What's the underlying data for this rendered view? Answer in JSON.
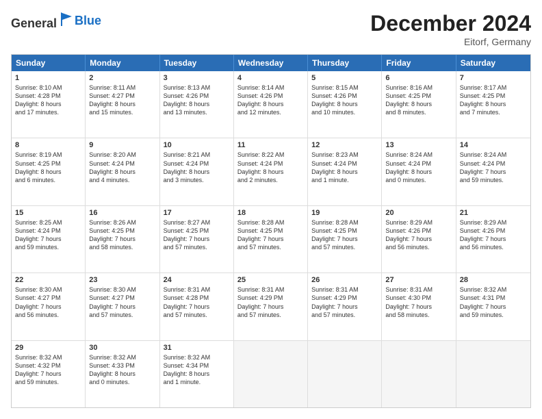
{
  "header": {
    "logo_general": "General",
    "logo_blue": "Blue",
    "title": "December 2024",
    "subtitle": "Eitorf, Germany"
  },
  "days": [
    "Sunday",
    "Monday",
    "Tuesday",
    "Wednesday",
    "Thursday",
    "Friday",
    "Saturday"
  ],
  "rows": [
    [
      {
        "day": "1",
        "lines": [
          "Sunrise: 8:10 AM",
          "Sunset: 4:28 PM",
          "Daylight: 8 hours",
          "and 17 minutes."
        ]
      },
      {
        "day": "2",
        "lines": [
          "Sunrise: 8:11 AM",
          "Sunset: 4:27 PM",
          "Daylight: 8 hours",
          "and 15 minutes."
        ]
      },
      {
        "day": "3",
        "lines": [
          "Sunrise: 8:13 AM",
          "Sunset: 4:26 PM",
          "Daylight: 8 hours",
          "and 13 minutes."
        ]
      },
      {
        "day": "4",
        "lines": [
          "Sunrise: 8:14 AM",
          "Sunset: 4:26 PM",
          "Daylight: 8 hours",
          "and 12 minutes."
        ]
      },
      {
        "day": "5",
        "lines": [
          "Sunrise: 8:15 AM",
          "Sunset: 4:26 PM",
          "Daylight: 8 hours",
          "and 10 minutes."
        ]
      },
      {
        "day": "6",
        "lines": [
          "Sunrise: 8:16 AM",
          "Sunset: 4:25 PM",
          "Daylight: 8 hours",
          "and 8 minutes."
        ]
      },
      {
        "day": "7",
        "lines": [
          "Sunrise: 8:17 AM",
          "Sunset: 4:25 PM",
          "Daylight: 8 hours",
          "and 7 minutes."
        ]
      }
    ],
    [
      {
        "day": "8",
        "lines": [
          "Sunrise: 8:19 AM",
          "Sunset: 4:25 PM",
          "Daylight: 8 hours",
          "and 6 minutes."
        ]
      },
      {
        "day": "9",
        "lines": [
          "Sunrise: 8:20 AM",
          "Sunset: 4:24 PM",
          "Daylight: 8 hours",
          "and 4 minutes."
        ]
      },
      {
        "day": "10",
        "lines": [
          "Sunrise: 8:21 AM",
          "Sunset: 4:24 PM",
          "Daylight: 8 hours",
          "and 3 minutes."
        ]
      },
      {
        "day": "11",
        "lines": [
          "Sunrise: 8:22 AM",
          "Sunset: 4:24 PM",
          "Daylight: 8 hours",
          "and 2 minutes."
        ]
      },
      {
        "day": "12",
        "lines": [
          "Sunrise: 8:23 AM",
          "Sunset: 4:24 PM",
          "Daylight: 8 hours",
          "and 1 minute."
        ]
      },
      {
        "day": "13",
        "lines": [
          "Sunrise: 8:24 AM",
          "Sunset: 4:24 PM",
          "Daylight: 8 hours",
          "and 0 minutes."
        ]
      },
      {
        "day": "14",
        "lines": [
          "Sunrise: 8:24 AM",
          "Sunset: 4:24 PM",
          "Daylight: 7 hours",
          "and 59 minutes."
        ]
      }
    ],
    [
      {
        "day": "15",
        "lines": [
          "Sunrise: 8:25 AM",
          "Sunset: 4:24 PM",
          "Daylight: 7 hours",
          "and 59 minutes."
        ]
      },
      {
        "day": "16",
        "lines": [
          "Sunrise: 8:26 AM",
          "Sunset: 4:25 PM",
          "Daylight: 7 hours",
          "and 58 minutes."
        ]
      },
      {
        "day": "17",
        "lines": [
          "Sunrise: 8:27 AM",
          "Sunset: 4:25 PM",
          "Daylight: 7 hours",
          "and 57 minutes."
        ]
      },
      {
        "day": "18",
        "lines": [
          "Sunrise: 8:28 AM",
          "Sunset: 4:25 PM",
          "Daylight: 7 hours",
          "and 57 minutes."
        ]
      },
      {
        "day": "19",
        "lines": [
          "Sunrise: 8:28 AM",
          "Sunset: 4:25 PM",
          "Daylight: 7 hours",
          "and 57 minutes."
        ]
      },
      {
        "day": "20",
        "lines": [
          "Sunrise: 8:29 AM",
          "Sunset: 4:26 PM",
          "Daylight: 7 hours",
          "and 56 minutes."
        ]
      },
      {
        "day": "21",
        "lines": [
          "Sunrise: 8:29 AM",
          "Sunset: 4:26 PM",
          "Daylight: 7 hours",
          "and 56 minutes."
        ]
      }
    ],
    [
      {
        "day": "22",
        "lines": [
          "Sunrise: 8:30 AM",
          "Sunset: 4:27 PM",
          "Daylight: 7 hours",
          "and 56 minutes."
        ]
      },
      {
        "day": "23",
        "lines": [
          "Sunrise: 8:30 AM",
          "Sunset: 4:27 PM",
          "Daylight: 7 hours",
          "and 57 minutes."
        ]
      },
      {
        "day": "24",
        "lines": [
          "Sunrise: 8:31 AM",
          "Sunset: 4:28 PM",
          "Daylight: 7 hours",
          "and 57 minutes."
        ]
      },
      {
        "day": "25",
        "lines": [
          "Sunrise: 8:31 AM",
          "Sunset: 4:29 PM",
          "Daylight: 7 hours",
          "and 57 minutes."
        ]
      },
      {
        "day": "26",
        "lines": [
          "Sunrise: 8:31 AM",
          "Sunset: 4:29 PM",
          "Daylight: 7 hours",
          "and 57 minutes."
        ]
      },
      {
        "day": "27",
        "lines": [
          "Sunrise: 8:31 AM",
          "Sunset: 4:30 PM",
          "Daylight: 7 hours",
          "and 58 minutes."
        ]
      },
      {
        "day": "28",
        "lines": [
          "Sunrise: 8:32 AM",
          "Sunset: 4:31 PM",
          "Daylight: 7 hours",
          "and 59 minutes."
        ]
      }
    ],
    [
      {
        "day": "29",
        "lines": [
          "Sunrise: 8:32 AM",
          "Sunset: 4:32 PM",
          "Daylight: 7 hours",
          "and 59 minutes."
        ]
      },
      {
        "day": "30",
        "lines": [
          "Sunrise: 8:32 AM",
          "Sunset: 4:33 PM",
          "Daylight: 8 hours",
          "and 0 minutes."
        ]
      },
      {
        "day": "31",
        "lines": [
          "Sunrise: 8:32 AM",
          "Sunset: 4:34 PM",
          "Daylight: 8 hours",
          "and 1 minute."
        ]
      },
      {
        "day": "",
        "lines": []
      },
      {
        "day": "",
        "lines": []
      },
      {
        "day": "",
        "lines": []
      },
      {
        "day": "",
        "lines": []
      }
    ]
  ]
}
